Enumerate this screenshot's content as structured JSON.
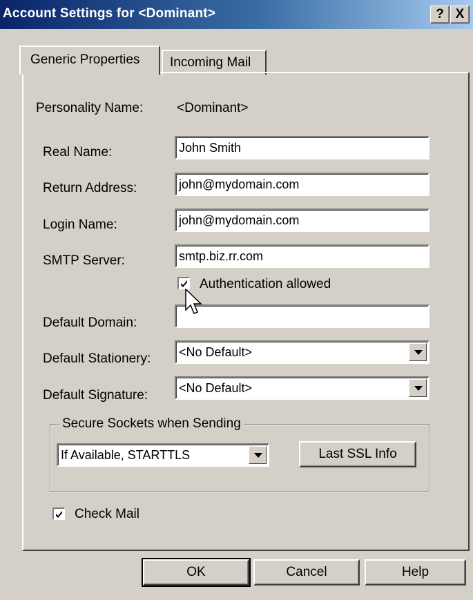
{
  "window": {
    "title": "Account Settings for <Dominant>",
    "help_glyph": "?",
    "close_glyph": "X"
  },
  "tabs": [
    {
      "label": "Generic Properties",
      "active": true
    },
    {
      "label": "Incoming Mail",
      "active": false
    }
  ],
  "personality": {
    "label": "Personality Name:",
    "value": "<Dominant>"
  },
  "fields": {
    "real_name": {
      "label": "Real Name:",
      "value": "John Smith"
    },
    "return_address": {
      "label": "Return Address:",
      "value": "john@mydomain.com"
    },
    "login_name": {
      "label": "Login Name:",
      "value": "john@mydomain.com"
    },
    "smtp_server": {
      "label": "SMTP Server:",
      "value": "smtp.biz.rr.com"
    },
    "default_domain": {
      "label": "Default Domain:",
      "value": ""
    },
    "default_stationery": {
      "label": "Default Stationery:",
      "value": "<No Default>"
    },
    "default_signature": {
      "label": "Default Signature:",
      "value": "<No Default>"
    }
  },
  "auth_checkbox": {
    "label": "Authentication allowed",
    "checked": true
  },
  "secure_sockets": {
    "group_label": "Secure Sockets when Sending",
    "selected": "If Available, STARTTLS",
    "ssl_button": "Last SSL Info"
  },
  "check_mail": {
    "label": "Check Mail",
    "checked": true
  },
  "buttons": {
    "ok": "OK",
    "cancel": "Cancel",
    "help": "Help"
  },
  "colors": {
    "title_bar_start": "#0a246a",
    "title_bar_end": "#a6caf0",
    "dialog_face": "#d4d0c8"
  },
  "icons": {
    "cursor": "arrow-pointer-icon",
    "checkmark": "check-icon",
    "combo": "chevron-down-icon"
  }
}
